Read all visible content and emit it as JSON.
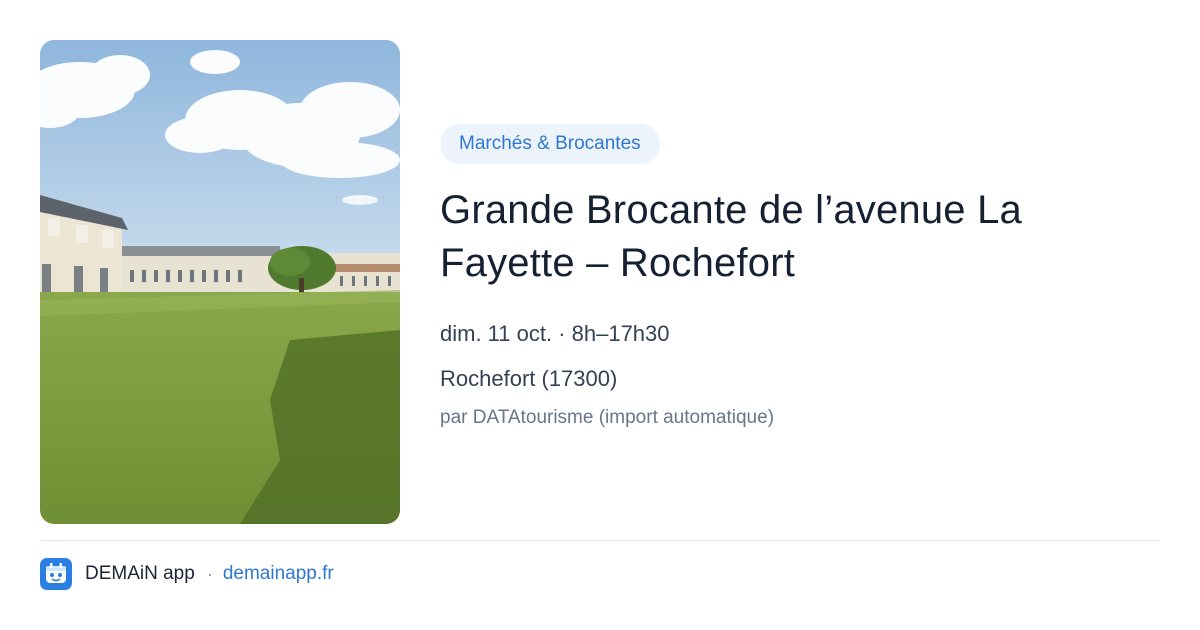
{
  "event": {
    "category": "Marchés & Brocantes",
    "title": "Grande Brocante de l’avenue La Fayette – Rochefort",
    "date": "dim. 11 oct. · 8h–17h30",
    "location": "Rochefort (17300)",
    "source": "par DATAtourisme (import automatique)",
    "image_icon": "photo-corderie-royale"
  },
  "footer": {
    "app_name": "DEMAiN app",
    "separator": "·",
    "link": "demainapp.fr",
    "logo_icon": "demain-app-icon"
  },
  "colors": {
    "accent": "#2f78d1",
    "tag_background": "#edf3fb",
    "title": "#162033",
    "divider": "#dde4ec"
  }
}
